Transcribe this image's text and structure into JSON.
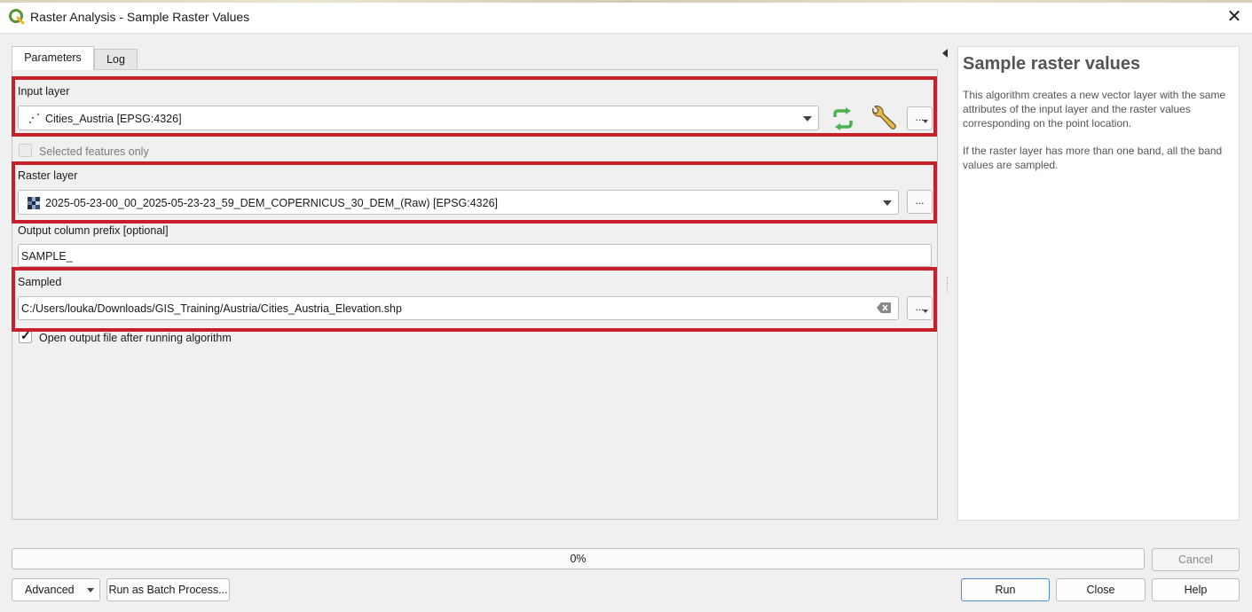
{
  "window": {
    "title": "Raster Analysis - Sample Raster Values",
    "close_glyph": "✕"
  },
  "tabs": [
    {
      "label": "Parameters",
      "active": true
    },
    {
      "label": "Log",
      "active": false
    }
  ],
  "params": {
    "input_layer": {
      "label": "Input layer",
      "value": "Cities_Austria [EPSG:4326]",
      "icon": "point-layer-icon"
    },
    "selected_only": {
      "label": "Selected features only",
      "checked": false,
      "enabled": false
    },
    "raster_layer": {
      "label": "Raster layer",
      "value": "2025-05-23-00_00_2025-05-23-23_59_DEM_COPERNICUS_30_DEM_(Raw) [EPSG:4326]",
      "icon": "raster-layer-icon"
    },
    "prefix": {
      "label": "Output column prefix [optional]",
      "value": "SAMPLE_"
    },
    "sampled": {
      "label": "Sampled",
      "value": "C:/Users/louka/Downloads/GIS_Training/Austria/Cities_Austria_Elevation.shp"
    },
    "open_output": {
      "label": "Open output file after running algorithm",
      "checked": true
    },
    "browse_label": "..."
  },
  "help": {
    "title": "Sample raster values",
    "paragraph1": "This algorithm creates a new vector layer with the same attributes of the input layer and the raster values corresponding on the point location.",
    "paragraph2": "If the raster layer has more than one band, all the band values are sampled."
  },
  "progress": {
    "percent": 0,
    "label": "0%"
  },
  "buttons": {
    "cancel": "Cancel",
    "advanced": "Advanced",
    "batch": "Run as Batch Process...",
    "run": "Run",
    "close": "Close",
    "help": "Help"
  },
  "colors": {
    "highlight": "#c8202a",
    "iterate_icon": "#4caf50",
    "qgis_brand": "#589632"
  }
}
